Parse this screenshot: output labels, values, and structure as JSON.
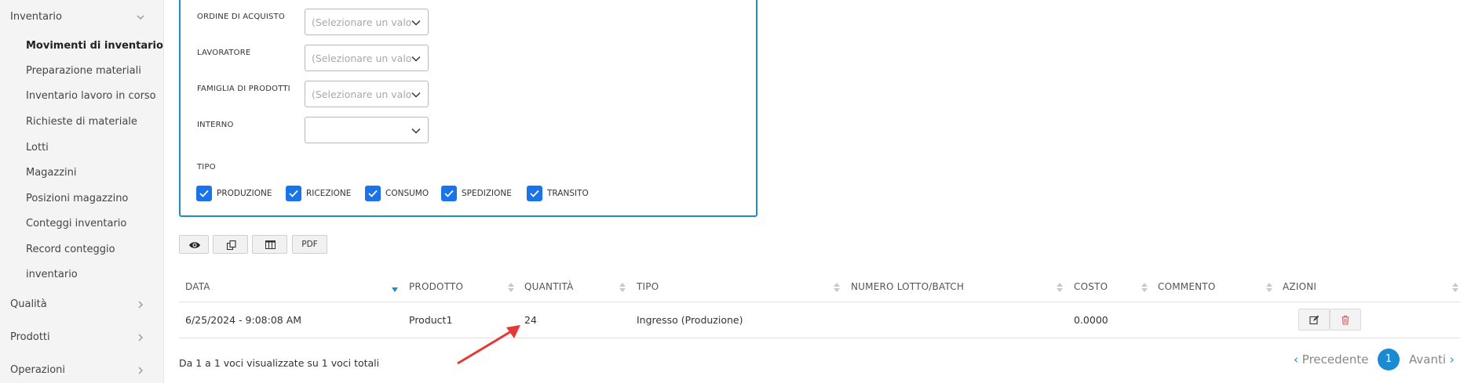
{
  "sidebar": {
    "groups": [
      {
        "label": "Inventario",
        "expanded": true
      },
      {
        "label": "Qualità"
      },
      {
        "label": "Prodotti"
      },
      {
        "label": "Operazioni"
      }
    ],
    "inventory_items": [
      "Movimenti di inventario",
      "Preparazione materiali",
      "Inventario lavoro in corso",
      "Richieste di materiale",
      "Lotti",
      "Magazzini",
      "Posizioni magazzino",
      "Conteggi inventario",
      "Record conteggio",
      "inventario"
    ],
    "active_item": "Movimenti di inventario"
  },
  "filters": {
    "ordine": {
      "label": "ORDINE DI ACQUISTO",
      "placeholder": "(Selezionare un valore)"
    },
    "lavoratore": {
      "label": "LAVORATORE",
      "placeholder": "(Selezionare un valore)"
    },
    "famiglia": {
      "label": "FAMIGLIA DI PRODOTTI",
      "placeholder": "(Selezionare un valore)"
    },
    "interno": {
      "label": "INTERNO",
      "value": ""
    },
    "tipo_label": "TIPO",
    "tipo_options": [
      {
        "label": "PRODUZIONE",
        "checked": true
      },
      {
        "label": "RICEZIONE",
        "checked": true
      },
      {
        "label": "CONSUMO",
        "checked": true
      },
      {
        "label": "SPEDIZIONE",
        "checked": true
      },
      {
        "label": "TRANSITO",
        "checked": true
      }
    ]
  },
  "toolbar": {
    "buttons": [
      {
        "icon": "eye-icon"
      },
      {
        "icon": "copy-icon"
      },
      {
        "icon": "columns-icon"
      },
      {
        "label": "PDF"
      }
    ]
  },
  "table": {
    "columns": [
      "DATA",
      "PRODOTTO",
      "QUANTITÀ",
      "TIPO",
      "NUMERO LOTTO/BATCH",
      "COSTO",
      "COMMENTO",
      "AZIONI"
    ],
    "sorted_column": "DATA",
    "rows": [
      {
        "data": "6/25/2024 - 9:08:08 AM",
        "prodotto": "Product1",
        "quantita": "24",
        "tipo": "Ingresso (Produzione)",
        "lotto": "",
        "costo": "0.0000",
        "commento": ""
      }
    ]
  },
  "footer": {
    "info": "Da 1 a 1 voci visualizzate su 1 voci totali",
    "prev_label": "Precedente",
    "current_page": "1",
    "next_label": "Avanti"
  },
  "colors": {
    "accent": "#1f8dc6",
    "checkbox": "#1a73e8",
    "annotation_arrow": "#e53935"
  }
}
